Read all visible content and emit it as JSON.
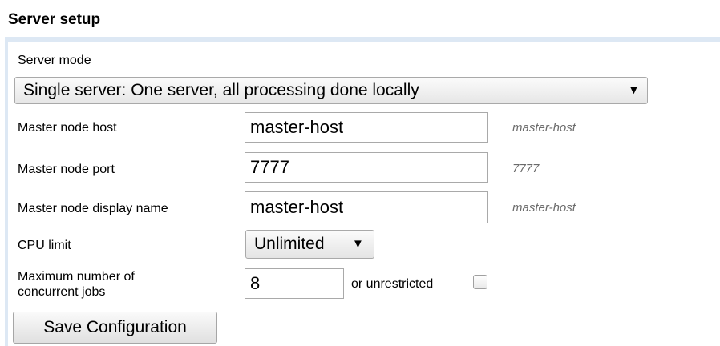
{
  "section": {
    "title": "Server setup"
  },
  "server_mode": {
    "label": "Server mode",
    "selected": "Single server: One server, all processing done locally",
    "arrow": "▼"
  },
  "master_host": {
    "label": "Master node host",
    "value": "master-host",
    "hint": "master-host"
  },
  "master_port": {
    "label": "Master node port",
    "value": "7777",
    "hint": "7777"
  },
  "master_display_name": {
    "label": "Master node display name",
    "value": "master-host",
    "hint": "master-host"
  },
  "cpu_limit": {
    "label": "CPU limit",
    "selected": "Unlimited",
    "arrow": "▼"
  },
  "max_jobs": {
    "label_line1": "Maximum number of",
    "label_line2": "concurrent jobs",
    "value": "8",
    "unrestricted_label": "or unrestricted",
    "unrestricted_checked": false
  },
  "actions": {
    "save_label": "Save Configuration"
  }
}
